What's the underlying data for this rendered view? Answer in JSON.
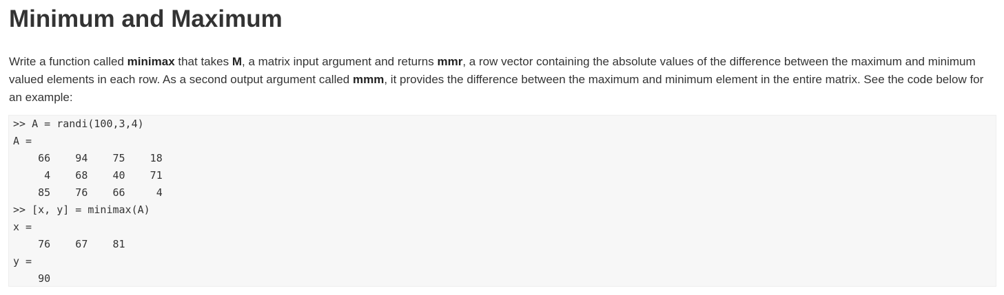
{
  "title": "Minimum and Maximum",
  "description": {
    "t1": "Write a function called ",
    "b1": "minimax",
    "t2": " that takes ",
    "b2": "M",
    "t3": ", a matrix input argument and returns ",
    "b3": "mmr",
    "t4": ", a row vector containing the absolute values of the difference between the maximum and minimum valued elements in each row. As a second output argument called ",
    "b4": "mmm",
    "t5": ", it provides the difference between the maximum and minimum element in the entire matrix. See the code below for an example:"
  },
  "code_lines": [
    ">> A = randi(100,3,4)",
    "A =",
    "    66    94    75    18",
    "     4    68    40    71",
    "    85    76    66     4",
    ">> [x, y] = minimax(A)",
    "x =",
    "    76    67    81",
    "y =",
    "    90"
  ]
}
